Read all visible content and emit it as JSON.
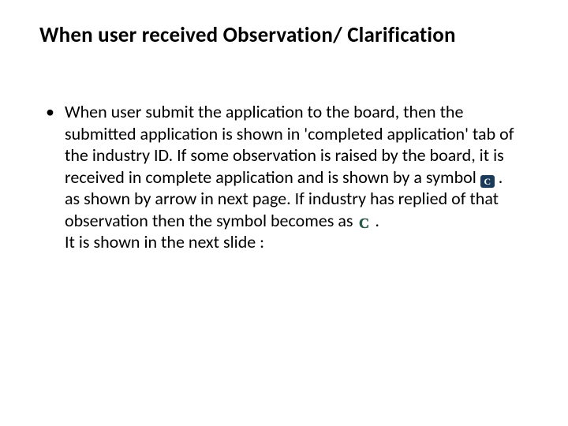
{
  "slide": {
    "title": "When user received Observation/ Clarification",
    "bullet": {
      "seg1": "When user submit the application to the board, then the submitted application is shown in 'completed application' tab of the industry ID. If some observation is raised by the board, it is received in complete application and is shown by a symbol ",
      "seg2": " . as shown by arrow in next page. If industry has replied of that observation then the symbol becomes as ",
      "seg3": " .",
      "seg4": "It is shown in the next slide :"
    },
    "icons": {
      "filled_letter": "C",
      "outline_letter": "C"
    }
  }
}
